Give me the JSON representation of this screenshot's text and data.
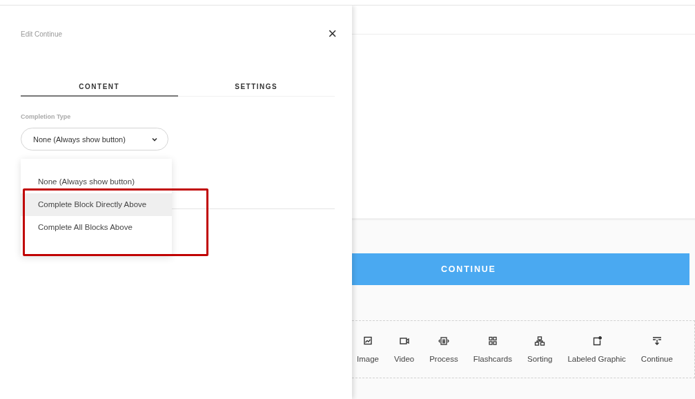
{
  "panel": {
    "title": "Edit Continue",
    "close": "×",
    "tabs": [
      {
        "label": "CONTENT",
        "selected": true
      },
      {
        "label": "SETTINGS",
        "selected": false
      }
    ],
    "field_label": "Completion Type",
    "select": {
      "value": "None (Always show button)",
      "expanded": true,
      "options": [
        {
          "label": "None (Always show button)",
          "highlighted": false
        },
        {
          "label": "Complete Block Directly Above",
          "highlighted": true
        },
        {
          "label": "Complete All Blocks Above",
          "highlighted": false
        }
      ]
    },
    "highlight_box": {
      "shown": true
    }
  },
  "main": {
    "continue_button": "CONTINUE",
    "blocks": [
      {
        "label": "Image",
        "kind": "image"
      },
      {
        "label": "Video",
        "kind": "video"
      },
      {
        "label": "Process",
        "kind": "process"
      },
      {
        "label": "Flashcards",
        "kind": "flashcards"
      },
      {
        "label": "Sorting",
        "kind": "sorting"
      },
      {
        "label": "Labeled Graphic",
        "kind": "labeled"
      },
      {
        "label": "Continue",
        "kind": "continue"
      }
    ]
  }
}
